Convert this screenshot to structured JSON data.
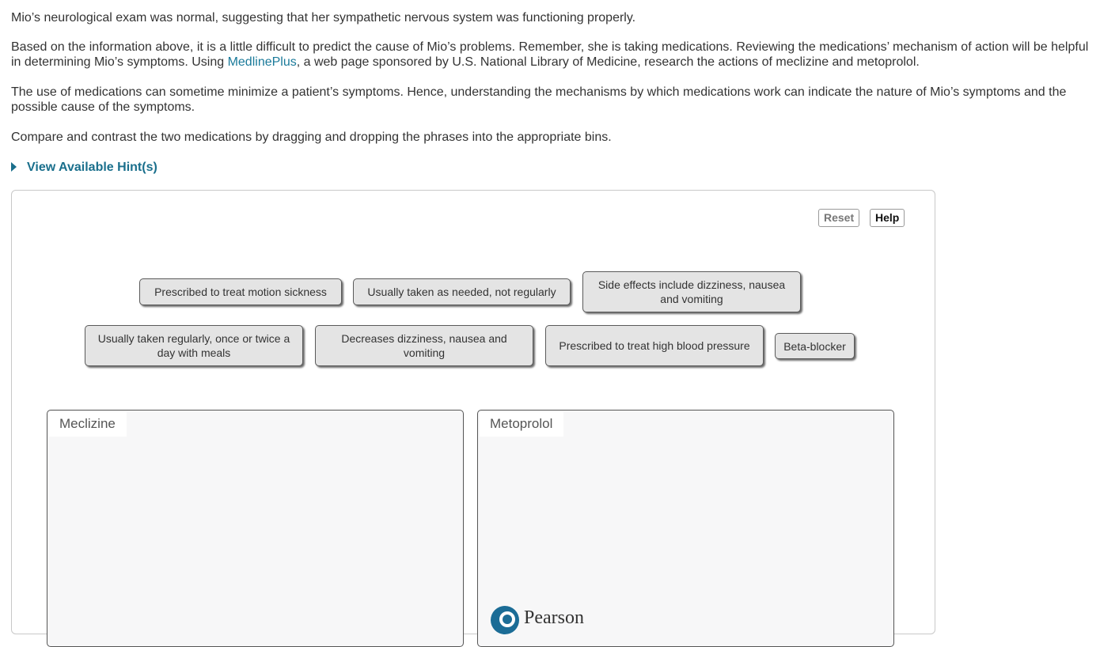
{
  "intro": {
    "p1": "Mio’s neurological exam was normal, suggesting that her sympathetic nervous system was functioning properly.",
    "p2_before": "Based on the information above, it is a little difficult to predict the cause of Mio’s problems. Remember, she is taking medications. Reviewing the medications’ mechanism of action will be helpful in determining Mio’s symptoms. Using ",
    "p2_link": "MedlinePlus",
    "p2_after": ", a web page sponsored by U.S. National Library of Medicine, research the actions of meclizine and metoprolol.",
    "p3": "The use of medications can sometime minimize a patient’s symptoms. Hence, understanding the mechanisms by which medications work can indicate the nature of Mio’s symptoms and the possible cause of the symptoms.",
    "p4": "Compare and contrast the two medications by dragging and dropping the phrases into the appropriate bins."
  },
  "hint": {
    "label": "View Available Hint(s)",
    "icon": "triangle-right-icon"
  },
  "toolbar": {
    "reset": "Reset",
    "help": "Help"
  },
  "chips": [
    "Prescribed to treat motion sickness",
    "Usually taken as needed, not regularly",
    "Side effects include dizziness, nausea and vomiting",
    "Usually taken regularly, once or twice a day with meals",
    "Decreases dizziness, nausea and vomiting",
    "Prescribed to treat high blood pressure",
    "Beta-blocker"
  ],
  "bins": [
    {
      "label": "Meclizine"
    },
    {
      "label": "Metoprolol"
    }
  ],
  "footer": {
    "logo_text": "Pearson"
  },
  "colors": {
    "link": "#1a7a9a",
    "hint": "#1a6f8c",
    "chip_bg": "#e4e4e4",
    "bin_bg": "#f7f7f8",
    "logo": "#1b6c96"
  }
}
